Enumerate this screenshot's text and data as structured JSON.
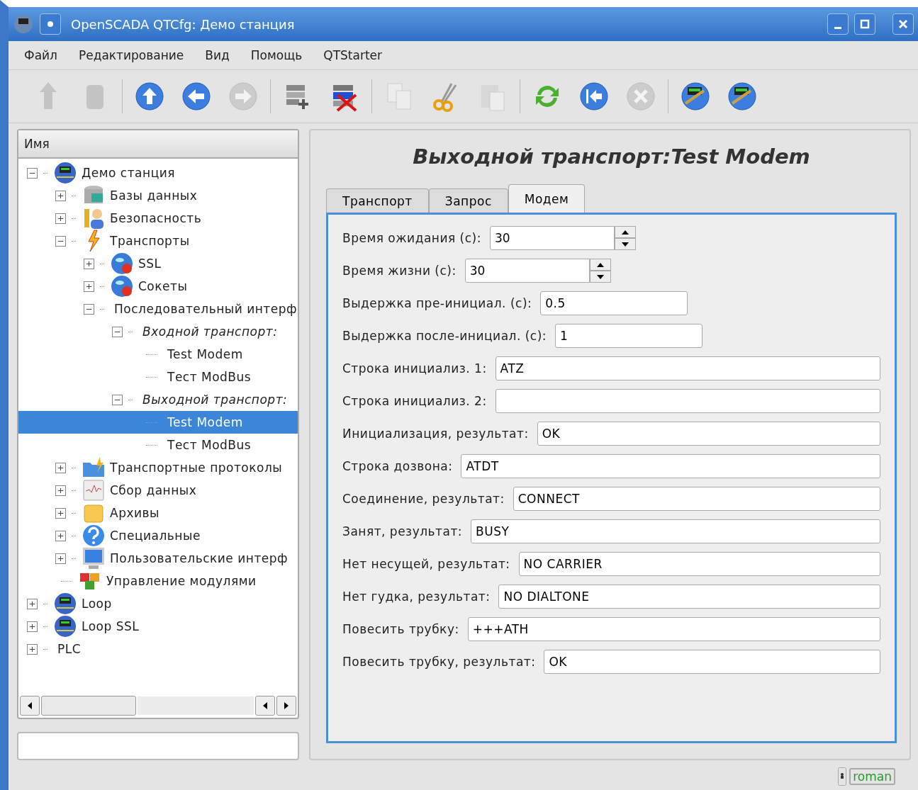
{
  "window": {
    "title": "OpenSCADA QTCfg: Демо станция"
  },
  "menu": [
    "Файл",
    "Редактирование",
    "Вид",
    "Помощь",
    "QTStarter"
  ],
  "toolbar": [
    [
      {
        "kind": "db-up",
        "disabled": true
      },
      {
        "kind": "db-down",
        "disabled": true
      }
    ],
    [
      {
        "kind": "up",
        "disabled": false
      },
      {
        "kind": "back",
        "disabled": false
      },
      {
        "kind": "forward",
        "disabled": true
      }
    ],
    [
      {
        "kind": "add",
        "disabled": false
      },
      {
        "kind": "delete",
        "disabled": false
      }
    ],
    [
      {
        "kind": "copy",
        "disabled": true
      },
      {
        "kind": "cut",
        "disabled": false
      },
      {
        "kind": "paste",
        "disabled": true
      }
    ],
    [
      {
        "kind": "refresh",
        "disabled": false
      },
      {
        "kind": "start",
        "disabled": false
      },
      {
        "kind": "stop",
        "disabled": true
      }
    ],
    [
      {
        "kind": "station",
        "disabled": false
      },
      {
        "kind": "station",
        "disabled": false
      }
    ]
  ],
  "tree": {
    "header": "Имя",
    "items": [
      {
        "label": "Демо станция",
        "kind": "node",
        "selected": false,
        "expanded": true,
        "children": [
          {
            "label": "Базы данных",
            "kind": "node",
            "selected": false,
            "expanded": false
          },
          {
            "label": "Безопасность",
            "kind": "node",
            "selected": false,
            "expanded": false
          },
          {
            "label": "Транспорты",
            "kind": "node",
            "selected": false,
            "expanded": true,
            "children": [
              {
                "label": "SSL",
                "kind": "node",
                "selected": false,
                "expanded": false
              },
              {
                "label": "Сокеты",
                "kind": "node",
                "selected": false,
                "expanded": false
              },
              {
                "label": "Последовательный интерф",
                "kind": "node",
                "selected": false,
                "expanded": true,
                "children": [
                  {
                    "label": "Входной транспорт:",
                    "kind": "group",
                    "selected": false,
                    "expanded": true,
                    "children": [
                      {
                        "label": "Test Modem",
                        "kind": "leaf",
                        "selected": false
                      },
                      {
                        "label": "Тест ModBus",
                        "kind": "leaf",
                        "selected": false
                      }
                    ]
                  },
                  {
                    "label": "Выходной транспорт:",
                    "kind": "group",
                    "selected": false,
                    "expanded": true,
                    "children": [
                      {
                        "label": "Test Modem",
                        "kind": "leaf",
                        "selected": true
                      },
                      {
                        "label": "Тест ModBus",
                        "kind": "leaf",
                        "selected": false
                      }
                    ]
                  }
                ]
              }
            ]
          },
          {
            "label": "Транспортные протоколы",
            "kind": "node",
            "selected": false,
            "expanded": false
          },
          {
            "label": "Сбор данных",
            "kind": "node",
            "selected": false,
            "expanded": false
          },
          {
            "label": "Архивы",
            "kind": "node",
            "selected": false,
            "expanded": false
          },
          {
            "label": "Специальные",
            "kind": "node",
            "selected": false,
            "expanded": false
          },
          {
            "label": "Пользовательские интерф",
            "kind": "node",
            "selected": false,
            "expanded": false
          },
          {
            "label": "Управление модулями",
            "kind": "leaf",
            "selected": false
          }
        ]
      },
      {
        "label": "Loop",
        "kind": "node",
        "selected": false,
        "expanded": false
      },
      {
        "label": "Loop SSL",
        "kind": "node",
        "selected": false,
        "expanded": false
      },
      {
        "label": "PLC",
        "kind": "node",
        "selected": false,
        "expanded": false
      }
    ]
  },
  "page": {
    "title": "Выходной транспорт:Test Modem",
    "tabs": [
      {
        "label": "Транспорт",
        "selected": false
      },
      {
        "label": "Запрос",
        "selected": false
      },
      {
        "label": "Модем",
        "selected": true
      }
    ],
    "fields": [
      {
        "label": "Время ожидания (с):",
        "value": "30",
        "kind": "spin"
      },
      {
        "label": "Время жизни (с):",
        "value": "30",
        "kind": "spin"
      },
      {
        "label": "Выдержка пре-инициал. (с):",
        "value": "0.5",
        "kind": "short"
      },
      {
        "label": "Выдержка после-инициал. (с):",
        "value": "1",
        "kind": "short"
      },
      {
        "label": "Строка инициализ. 1:",
        "value": "ATZ",
        "kind": "wide"
      },
      {
        "label": "Строка инициализ. 2:",
        "kind": "wide"
      },
      {
        "label": "Инициализация, результат:",
        "value": "OK",
        "kind": "wide"
      },
      {
        "label": "Строка дозвона:",
        "value": "ATDT",
        "kind": "wide"
      },
      {
        "label": "Соединение, результат:",
        "value": "CONNECT",
        "kind": "wide"
      },
      {
        "label": "Занят, результат:",
        "value": "BUSY",
        "kind": "wide"
      },
      {
        "label": "Нет несущей, результат:",
        "value": "NO CARRIER",
        "kind": "wide"
      },
      {
        "label": "Нет гудка, результат:",
        "value": "NO DIALTONE",
        "kind": "wide"
      },
      {
        "label": "Повесить трубку:",
        "value": "+++ATH",
        "kind": "wide"
      },
      {
        "label": "Повесить трубку, результат:",
        "value": "OK",
        "kind": "wide"
      }
    ]
  },
  "status_bar": {
    "user": "roman"
  }
}
